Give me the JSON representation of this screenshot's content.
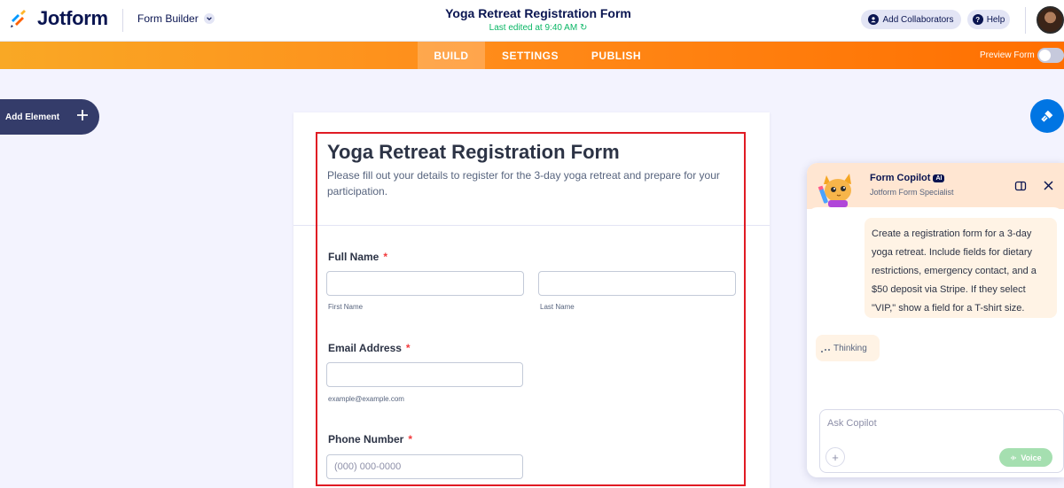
{
  "header": {
    "logo_text": "Jotform",
    "builder_label": "Form Builder",
    "doc_title": "Yoga Retreat Registration Form",
    "last_edited": "Last edited at 9:40 AM",
    "collab_label": "Add Collaborators",
    "help_label": "Help"
  },
  "tabs": [
    {
      "label": "BUILD",
      "active": true
    },
    {
      "label": "SETTINGS",
      "active": false
    },
    {
      "label": "PUBLISH",
      "active": false
    }
  ],
  "preview_label": "Preview Form",
  "add_element_label": "Add Element",
  "form": {
    "title": "Yoga Retreat Registration Form",
    "description": "Please fill out your details to register for the 3-day yoga retreat and prepare for your participation.",
    "full_name_label": "Full Name",
    "first_name_sub": "First Name",
    "last_name_sub": "Last Name",
    "email_label": "Email Address",
    "email_sub": "example@example.com",
    "phone_label": "Phone Number",
    "phone_placeholder": "(000) 000-0000",
    "required_mark": "*"
  },
  "copilot": {
    "name": "Form Copilot",
    "badge": "AI",
    "subtitle": "Jotform Form Specialist",
    "user_message": "Create a registration form for a 3-day yoga retreat. Include fields for dietary restrictions, emergency contact, and a $50 deposit via Stripe. If they select \"VIP,\" show a field for a T-shirt size.",
    "thinking_label": "Thinking",
    "input_placeholder": "Ask Copilot",
    "voice_label": "Voice"
  },
  "colors": {
    "accent_orange": "#ff6f00",
    "navy": "#0a1551",
    "highlight_red": "#e01b24",
    "blue": "#0075e3",
    "green": "#09b665"
  }
}
